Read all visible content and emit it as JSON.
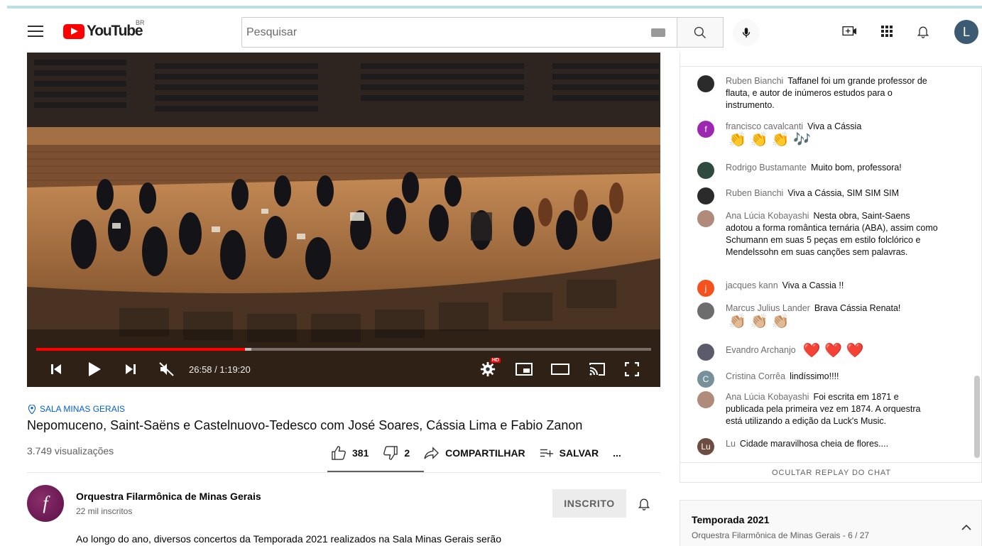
{
  "header": {
    "logo_text": "YouTube",
    "region": "BR",
    "search_placeholder": "Pesquisar",
    "avatar_letter": "L"
  },
  "player": {
    "time": "26:58 / 1:19:20",
    "progress_fraction": 0.34,
    "loaded_fraction": 0.35,
    "hd_badge": "HD"
  },
  "video": {
    "location": "SALA MINAS GERAIS",
    "title": "Nepomuceno, Saint-Saëns e Castelnuovo-Tedesco com José Soares, Cássia Lima e Fabio Zanon",
    "views": "3.749 visualizações",
    "likes": "381",
    "dislikes": "2",
    "share_label": "COMPARTILHAR",
    "save_label": "SALVAR",
    "more_label": "..."
  },
  "channel": {
    "avatar_letter": "f",
    "name": "Orquestra Filarmônica de Minas Gerais",
    "subscribers": "22 mil inscritos",
    "subscribe_label": "INSCRITO",
    "description": "Ao longo do ano, diversos concertos da Temporada 2021 realizados na Sala Minas Gerais serão"
  },
  "chat": {
    "messages": [
      {
        "author": "Ruben Bianchi",
        "text": "Taffanel foi um grande professor de flauta, e autor de inúmeros estudos para o instrumento.",
        "avatar": "",
        "avatar_color": "#2b2b2b"
      },
      {
        "author": "francisco cavalcanti",
        "text": "Viva a Cássia",
        "emoji": "👏 👏 👏 🎶",
        "avatar": "f",
        "avatar_color": "#9c27b0"
      },
      {
        "author": "Rodrigo Bustamante",
        "text": "Muito bom, professora!",
        "avatar": "",
        "avatar_color": "#2f4a3e"
      },
      {
        "author": "Ruben Bianchi",
        "text": "Viva a Cássia, SIM SIM SIM",
        "avatar": "",
        "avatar_color": "#2b2b2b"
      },
      {
        "author": "Ana Lúcia Kobayashi",
        "text": "Nesta obra, Saint-Saens adotou a forma romântica ternária (ABA), assim como Schumann em suas 5 peças em estilo folclórico e Mendelssohn em suas canções sem palavras.",
        "avatar": "",
        "avatar_color": "#b08a7a"
      },
      {
        "author": "jacques kann",
        "text": "Viva a Cassia !!",
        "avatar": "j",
        "avatar_color": "#f4511e"
      },
      {
        "author": "Marcus Julius Lander",
        "text": "Brava Cássia Renata!",
        "emoji": "👏🏼 👏🏼 👏🏼",
        "avatar": "",
        "avatar_color": "#6d6d6d"
      },
      {
        "author": "Evandro Archanjo",
        "text": "",
        "emoji": "❤️ ❤️ ❤️",
        "avatar": "",
        "avatar_color": "#5b5b6b"
      },
      {
        "author": "Cristina Corrêa",
        "text": "lindíssimo!!!!",
        "avatar": "C",
        "avatar_color": "#78909c"
      },
      {
        "author": "Ana Lúcia Kobayashi",
        "text": "Foi escrita em 1871 e publicada pela primeira vez em 1874. A orquestra está utilizando a edição da Luck's Music.",
        "avatar": "",
        "avatar_color": "#b08a7a"
      },
      {
        "author": "Lu",
        "text": "Cidade maravilhosa cheia de flores....",
        "avatar": "Lu",
        "avatar_color": "#6d4c41"
      }
    ],
    "hide_replay_label": "OCULTAR REPLAY DO CHAT"
  },
  "playlist": {
    "title": "Temporada 2021",
    "subtitle": "Orquestra Filarmônica de Minas Gerais - 6 / 27"
  },
  "colors": {
    "brand_red": "#ff0000",
    "link_blue": "#065fd4"
  }
}
